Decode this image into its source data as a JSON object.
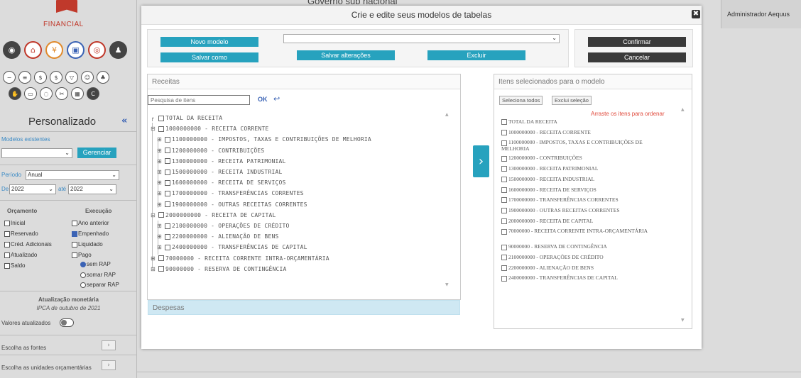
{
  "background": {
    "page_title": "Governo sub nacional",
    "user": "Administrador Aequus",
    "logo_text": "FINANCIAL"
  },
  "sidebar": {
    "title": "Personalizado",
    "collapse_icon": "«",
    "modelos_label": "Modelos existentes",
    "modelos_value": "",
    "gerenciar_label": "Gerenciar",
    "periodo_label": "Período",
    "periodo_value": "Anual",
    "de_label": "De",
    "de_value": "2022",
    "ate_label": "até",
    "ate_value": "2022",
    "orcamento_label": "Orçamento",
    "execucao_label": "Execução",
    "orcamento_items": [
      "Inicial",
      "Reservado",
      "Créd. Adicionais",
      "Atualizado",
      "Saldo"
    ],
    "execucao_items": [
      {
        "label": "Ano anterior",
        "checked": false
      },
      {
        "label": "Empenhado",
        "checked": true
      },
      {
        "label": "Liquidado",
        "checked": false
      },
      {
        "label": "Pago",
        "checked": false
      }
    ],
    "rap_options": [
      {
        "label": "sem RAP",
        "selected": true
      },
      {
        "label": "somar RAP",
        "selected": false
      },
      {
        "label": "separar RAP",
        "selected": false
      }
    ],
    "atualizacao_title": "Atualização monetária",
    "atualizacao_sub": "IPCA de outubro de 2021",
    "valores_atualizados": "Valores atualizados",
    "fontes": "Escolha as fontes",
    "unidades": "Escolha as unidades orçamentárias",
    "mini_arrow": "›"
  },
  "modal": {
    "title": "Crie e edite seus modelos de tabelas",
    "close_icon": "✖",
    "novo_modelo": "Novo modelo",
    "salvar_como": "Salvar como",
    "salvar_alteracoes": "Salvar alterações",
    "excluir": "Excluir",
    "confirmar": "Confirmar",
    "cancelar": "Cancelar",
    "model_select_value": "",
    "receitas_title": "Receitas",
    "search_placeholder": "Pesquisa de itens",
    "ok_label": "OK",
    "undo_icon": "↩",
    "despesas_title": "Despesas",
    "move_arrow": "›",
    "selected_title": "Itens selecionados para o modelo",
    "seleciona_todos": "Seleciona todos",
    "exclui_selecao": "Exclui seleção",
    "hint": "Arraste os itens para ordenar",
    "tree": [
      {
        "label": "TOTAL DA RECEITA",
        "level": 0,
        "expander": "┌"
      },
      {
        "label": "1000000000 - RECEITA CORRENTE",
        "level": 0,
        "expander": "⊟"
      },
      {
        "label": "1100000000 - IMPOSTOS, TAXAS E CONTRIBUIÇÕES DE MELHORIA",
        "level": 1,
        "expander": "⊞"
      },
      {
        "label": "1200000000 - CONTRIBUIÇÕES",
        "level": 1,
        "expander": "⊞"
      },
      {
        "label": "1300000000 - RECEITA PATRIMONIAL",
        "level": 1,
        "expander": "⊞"
      },
      {
        "label": "1500000000 - RECEITA INDUSTRIAL",
        "level": 1,
        "expander": "⊞"
      },
      {
        "label": "1600000000 - RECEITA DE SERVIÇOS",
        "level": 1,
        "expander": "⊞"
      },
      {
        "label": "1700000000 - TRANSFERÊNCIAS CORRENTES",
        "level": 1,
        "expander": "⊞"
      },
      {
        "label": "1900000000 - OUTRAS RECEITAS CORRENTES",
        "level": 1,
        "expander": "⊞"
      },
      {
        "label": "2000000000 - RECEITA DE CAPITAL",
        "level": 0,
        "expander": "⊟"
      },
      {
        "label": "2100000000 - OPERAÇÕES DE CRÉDITO",
        "level": 1,
        "expander": "⊞"
      },
      {
        "label": "2200000000 - ALIENAÇÃO DE BENS",
        "level": 1,
        "expander": "⊞"
      },
      {
        "label": "2400000000 - TRANSFERÊNCIAS DE CAPITAL",
        "level": 1,
        "expander": "⊞"
      },
      {
        "label": "70000000 - RECEITA CORRENTE INTRA-ORÇAMENTÁRIA",
        "level": 0,
        "expander": "⊞"
      },
      {
        "label": "90000000 - RESERVA DE CONTINGÊNCIA",
        "level": 0,
        "expander": "⊞"
      }
    ],
    "selected_items": [
      "TOTAL DA RECEITA",
      "1000000000 - RECEITA CORRENTE",
      "1100000000 - IMPOSTOS, TAXAS E CONTRIBUIÇÕES DE MELHORIA",
      "1200000000 - CONTRIBUIÇÕES",
      "1300000000 - RECEITA PATRIMONIAL",
      "1500000000 - RECEITA INDUSTRIAL",
      "1600000000 - RECEITA DE SERVIÇOS",
      "1700000000 - TRANSFERÊNCIAS CORRENTES",
      "1900000000 - OUTRAS RECEITAS CORRENTES",
      "2000000000 - RECEITA DE CAPITAL",
      "70000000 - RECEITA CORRENTE INTRA-ORÇAMENTÁRIA",
      "90000000 - RESERVA DE CONTINGÊNCIA",
      "2100000000 - OPERAÇÕES DE CRÉDITO",
      "2200000000 - ALIENAÇÃO DE BENS",
      "2400000000 - TRANSFERÊNCIAS DE CAPITAL"
    ]
  },
  "colors": {
    "teal": "#27a2be",
    "dark_button": "#3a3a3a",
    "hint_red": "#e04a3c",
    "despesas_bg": "#cfe8f3"
  }
}
